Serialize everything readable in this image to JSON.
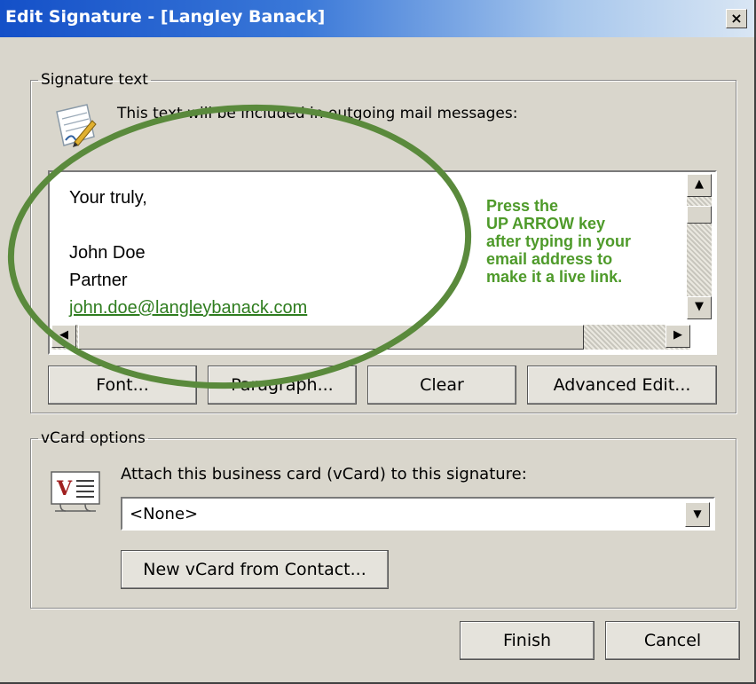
{
  "window": {
    "title": "Edit Signature - [Langley Banack]",
    "close_glyph": "×"
  },
  "signature": {
    "legend": "Signature text",
    "instruction": "This text will be included in outgoing mail messages:",
    "lines": [
      "Your truly,",
      "",
      "John Doe",
      "Partner"
    ],
    "email": "john.doe@langleybanack.com",
    "link_color": "#2f7d1f",
    "buttons": {
      "font": "Font...",
      "paragraph": "Paragraph...",
      "clear": "Clear",
      "advanced": "Advanced Edit..."
    }
  },
  "annotation": {
    "lines": [
      "Press the",
      "UP ARROW key",
      "after typing in your",
      "email address to",
      "make it a live link."
    ],
    "color": "#4e9a2a",
    "ellipse_color": "#5a8a3c"
  },
  "vcard": {
    "legend": "vCard options",
    "label": "Attach this business card (vCard) to this signature:",
    "selected": "<None>",
    "new_button": "New vCard from Contact..."
  },
  "footer": {
    "finish": "Finish",
    "cancel": "Cancel"
  },
  "icons": {
    "signature": "signature-pen-icon",
    "vcard": "vcard-icon"
  }
}
